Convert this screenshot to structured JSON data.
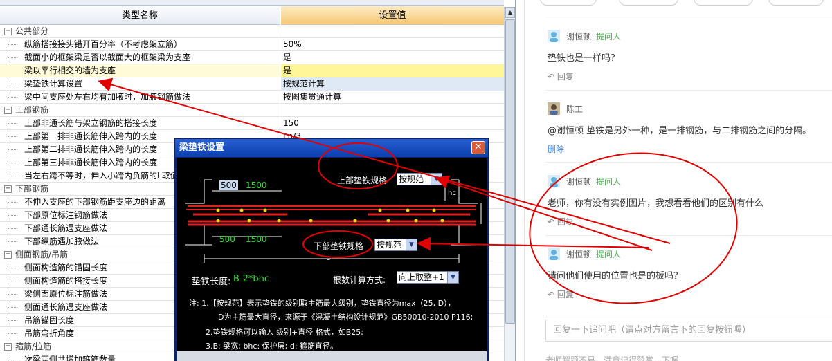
{
  "grid": {
    "header_name": "类型名称",
    "header_value": "设置值",
    "rows": [
      {
        "kind": "cat",
        "toggle": "−",
        "name": "公共部分",
        "value": ""
      },
      {
        "kind": "sub",
        "name": "纵筋搭接接头错开百分率（不考虑架立筋）",
        "value": "50%"
      },
      {
        "kind": "sub",
        "name": "截面小的框架梁是否以截面大的框架梁为支座",
        "value": "是"
      },
      {
        "kind": "sub",
        "name": "梁以平行相交的墙为支座",
        "value": "是",
        "highlight": true
      },
      {
        "kind": "sub",
        "name": "梁垫铁计算设置",
        "value": "按规范计算",
        "selected": true
      },
      {
        "kind": "sub",
        "name": "梁中间支座处左右均有加腋时，加腋钢筋做法",
        "value": "按图集贯通计算"
      },
      {
        "kind": "cat",
        "toggle": "−",
        "name": "上部钢筋",
        "value": ""
      },
      {
        "kind": "sub",
        "name": "上部非通长筋与架立钢筋的搭接长度",
        "value": "150"
      },
      {
        "kind": "sub",
        "name": "上部第一排非通长筋伸入跨内的长度",
        "value": "Ln/3"
      },
      {
        "kind": "sub",
        "name": "上部第二排非通长筋伸入跨内的长度",
        "value": ""
      },
      {
        "kind": "sub",
        "name": "上部第三排非通长筋伸入跨内的长度",
        "value": ""
      },
      {
        "kind": "sub",
        "name": "当左右跨不等时，伸入小跨内负筋的L取值",
        "value": ""
      },
      {
        "kind": "cat",
        "toggle": "−",
        "name": "下部钢筋",
        "value": ""
      },
      {
        "kind": "sub",
        "name": "不伸入支座的下部钢筋距支座边的距离",
        "value": ""
      },
      {
        "kind": "sub",
        "name": "下部原位标注钢筋做法",
        "value": ""
      },
      {
        "kind": "sub",
        "name": "下部通长筋遇支座做法",
        "value": ""
      },
      {
        "kind": "sub",
        "name": "下部纵筋遇加腋做法",
        "value": ""
      },
      {
        "kind": "cat",
        "toggle": "−",
        "name": "侧面钢筋/吊筋",
        "value": ""
      },
      {
        "kind": "sub",
        "name": "侧面构造筋的锚固长度",
        "value": ""
      },
      {
        "kind": "sub",
        "name": "侧面构造筋的搭接长度",
        "value": ""
      },
      {
        "kind": "sub",
        "name": "梁侧面原位标注筋做法",
        "value": ""
      },
      {
        "kind": "sub",
        "name": "侧面通长筋遇支座做法",
        "value": ""
      },
      {
        "kind": "sub",
        "name": "吊筋锚固长度",
        "value": ""
      },
      {
        "kind": "sub",
        "name": "吊筋弯折角度",
        "value": ""
      },
      {
        "kind": "cat",
        "toggle": "−",
        "name": "箍筋/拉筋",
        "value": ""
      },
      {
        "kind": "sub",
        "name": "次梁两侧共增加箍筋数量",
        "value": ""
      }
    ]
  },
  "dialog": {
    "title": "梁垫铁设置",
    "close": "✕",
    "dim_top_box": "500",
    "dim_top": "1500",
    "dim_bottom_left": "500",
    "dim_bottom": "1500",
    "dim_hc": "hc",
    "dim_L": "L",
    "top_label": "上部垫铁规格",
    "top_value": "按规范",
    "bottom_label": "下部垫铁规格",
    "bottom_value": "按规范",
    "length_label": "垫铁长度:",
    "length_value": "B-2*bhc",
    "count_label": "根数计算方式:",
    "count_value": "向上取整+1",
    "note1": "注: 1.【按规范】表示垫铁的级别取主筋最大级别，垫铁直径为max（25, D），",
    "note2": "D为主筋最大直径，来源于《混凝土结构设计规范》GB50010-2010 P116;",
    "note3": "2.垫铁规格可以输入 级别+直径 格式，如B25;",
    "note4": "3.B: 梁宽; bhc: 保护层; d: 箍筋直径。",
    "colors": {
      "rebar": "#e02020",
      "dot": "#ffd700",
      "dim": "#ffffff",
      "green": "#32e032"
    }
  },
  "comments": [
    {
      "user": "谢恒顿",
      "role": "提问人",
      "text": "垫铁也是一样吗？",
      "action": "回复"
    },
    {
      "user": "陈工",
      "role": "",
      "text": "@谢恒顿 垫铁是另外一种，是一排钢筋，与二排钢筋之间的分隔。",
      "action": "删除"
    },
    {
      "user": "谢恒顿",
      "role": "提问人",
      "text": "老师，你有没有实例图片，我想看看他们的区别有什么",
      "action": "回复"
    },
    {
      "user": "谢恒顿",
      "role": "提问人",
      "text": "请问他们使用的位置也是的板吗？",
      "action": "回复"
    }
  ],
  "reply_placeholder": "回复一下追问吧（请点对方留言下的回复按钮喔）",
  "bottom_hint": "老师解题不易，满意记得赞赏一下喔",
  "annotation_color": "#e00000"
}
